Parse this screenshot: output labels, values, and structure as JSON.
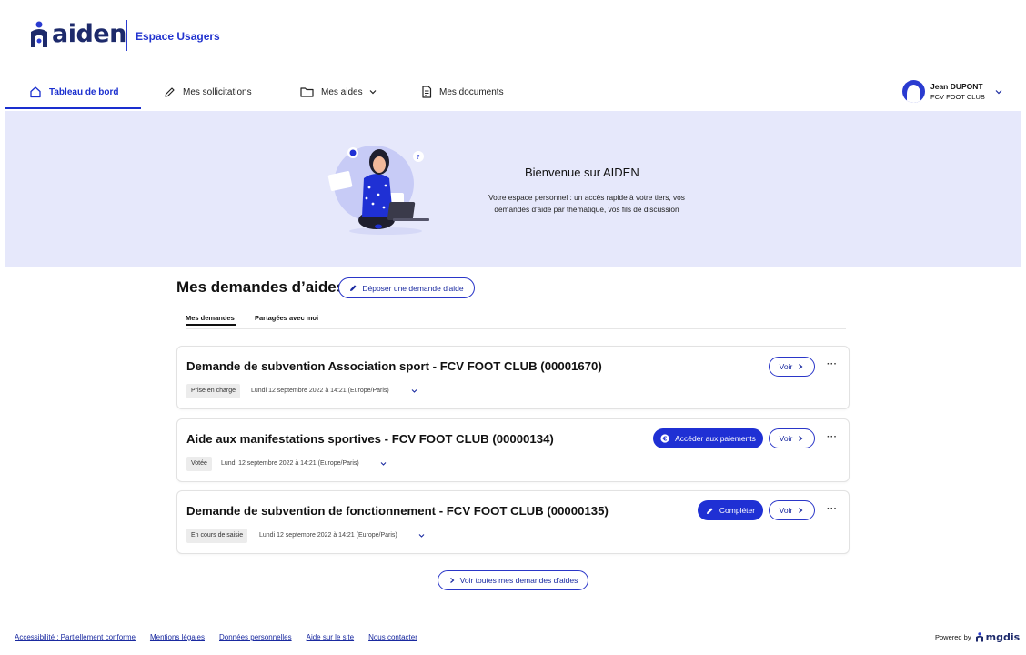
{
  "header": {
    "logo_text": "aiden",
    "space_label": "Espace Usagers",
    "brand_color": "#2234cf"
  },
  "nav": {
    "items": [
      {
        "label": "Tableau de bord",
        "icon": "home-icon",
        "active": true
      },
      {
        "label": "Mes sollicitations",
        "icon": "pencil-icon"
      },
      {
        "label": "Mes aides",
        "icon": "folder-icon",
        "has_dropdown": true
      },
      {
        "label": "Mes documents",
        "icon": "document-icon"
      }
    ]
  },
  "user": {
    "name": "Jean DUPONT",
    "org": "FCV FOOT CLUB"
  },
  "banner": {
    "title": "Bienvenue sur AIDEN",
    "description": "Votre espace personnel : un accès rapide à votre tiers, vos demandes d'aide par thématique, vos fils de discussion",
    "background": "#e6e8fb"
  },
  "section": {
    "title": "Mes demandes d’aides",
    "deposit_button": "Déposer une demande d'aide",
    "tabs": [
      "Mes demandes",
      "Partagées avec moi"
    ],
    "active_tab": "Mes demandes"
  },
  "requests": [
    {
      "title": "Demande de subvention Association sport - FCV FOOT CLUB (00001670)",
      "status": "Prise en charge",
      "date": "Lundi 12 septembre 2022 à 14:21 (Europe/Paris)",
      "view_label": "Voir",
      "action_label": ""
    },
    {
      "title": "Aide aux manifestations sportives - FCV FOOT CLUB (00000134)",
      "status": "Votée",
      "date": "Lundi 12 septembre 2022 à 14:21 (Europe/Paris)",
      "view_label": "Voir",
      "action_label": "Accéder aux paiements",
      "action_icon": "euro-icon"
    },
    {
      "title": "Demande de subvention de fonctionnement - FCV FOOT CLUB (00000135)",
      "status": "En cours de saisie",
      "date": "Lundi 12 septembre 2022 à 14:21 (Europe/Paris)",
      "view_label": "Voir",
      "action_label": "Compléter",
      "action_icon": "pencil-icon"
    }
  ],
  "more_menu": "···",
  "see_all_button": "Voir toutes mes demandes d'aides",
  "footer": {
    "links": [
      "Accessibilité : Partiellement conforme",
      "Mentions légales",
      "Données personnelles",
      "Aide sur le site",
      "Nous contacter"
    ],
    "powered_by": "Powered by",
    "powered_brand": "mgdis"
  }
}
